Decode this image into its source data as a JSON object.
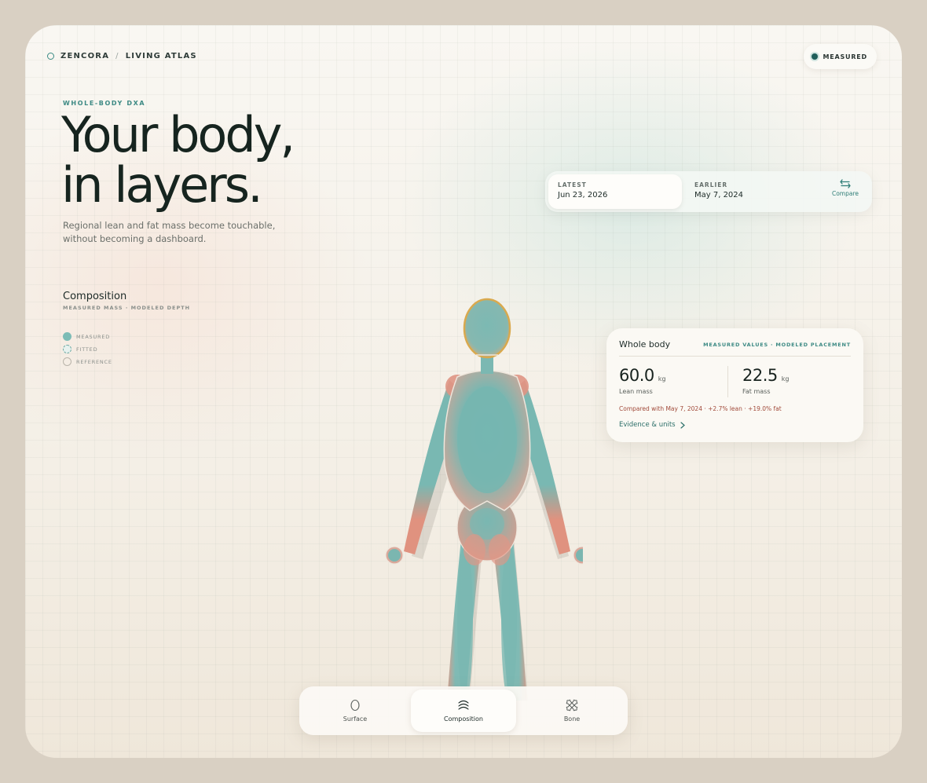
{
  "brand": {
    "name": "ZENCORA",
    "separator": "/",
    "section": "LIVING ATLAS"
  },
  "status": {
    "label": "MEASURED"
  },
  "hero": {
    "eyebrow": "WHOLE-BODY DXA",
    "title_line1": "Your body,",
    "title_line2": "in layers.",
    "subtitle": "Regional lean and fat mass become touchable, without becoming a dashboard."
  },
  "composition": {
    "title": "Composition",
    "subtitle": "MEASURED MASS · MODELED DEPTH",
    "legend": [
      "MEASURED",
      "FITTED",
      "REFERENCE"
    ]
  },
  "dates": {
    "latest_label": "LATEST",
    "latest_value": "Jun 23, 2026",
    "earlier_label": "EARLIER",
    "earlier_value": "May 7, 2024",
    "compare_label": "Compare"
  },
  "card": {
    "title": "Whole body",
    "meta": "MEASURED VALUES · MODELED PLACEMENT",
    "lean_value": "60.0",
    "lean_unit": "kg",
    "lean_label": "Lean mass",
    "fat_value": "22.5",
    "fat_unit": "kg",
    "fat_label": "Fat mass",
    "comparison": "Compared with May 7, 2024 · +2.7% lean · +19.0% fat",
    "evidence_link": "Evidence & units"
  },
  "modes": {
    "surface": "Surface",
    "composition": "Composition",
    "bone": "Bone",
    "active": "Composition"
  },
  "colors": {
    "lean": "#7cbcb6",
    "fat": "#e39b88",
    "accent": "#3d8a84",
    "highlight": "#d9a94e"
  }
}
